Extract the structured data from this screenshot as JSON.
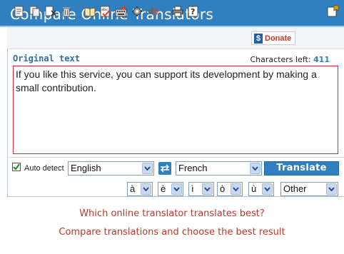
{
  "header": {
    "title": "Compare Online Translators"
  },
  "toolbar": {
    "icons": [
      "new-document-icon",
      "copy-icon",
      "cut-icon",
      "delete-icon",
      "dictionary-icon",
      "spellcheck-icon",
      "virtual-keyboard-icon",
      "settings-icon",
      "speaker-icon",
      "print-icon",
      "help-icon",
      "bookmark-icon"
    ],
    "donate_label": "Donate",
    "donate_symbol": "$"
  },
  "source": {
    "label": "Original text",
    "chars_left_label": "Characters left:",
    "chars_left_value": "411",
    "text": "If you like this service, you can support its development by making a small contribution."
  },
  "language_bar": {
    "auto_detect_label": "Auto detect",
    "auto_detect_checked": true,
    "source_language": "English",
    "target_language": "French",
    "translate_label": "Translate"
  },
  "special_chars": {
    "options": [
      "à",
      "è",
      "ì",
      "ò",
      "ù"
    ],
    "other_label": "Other"
  },
  "footer": {
    "line1": "Which online translator translates best?",
    "line2": "Compare translations and choose the best result"
  },
  "colors": {
    "header": "#2f7fc1",
    "accent_text": "#b53a2e",
    "textarea_border": "#cf2b2b"
  }
}
